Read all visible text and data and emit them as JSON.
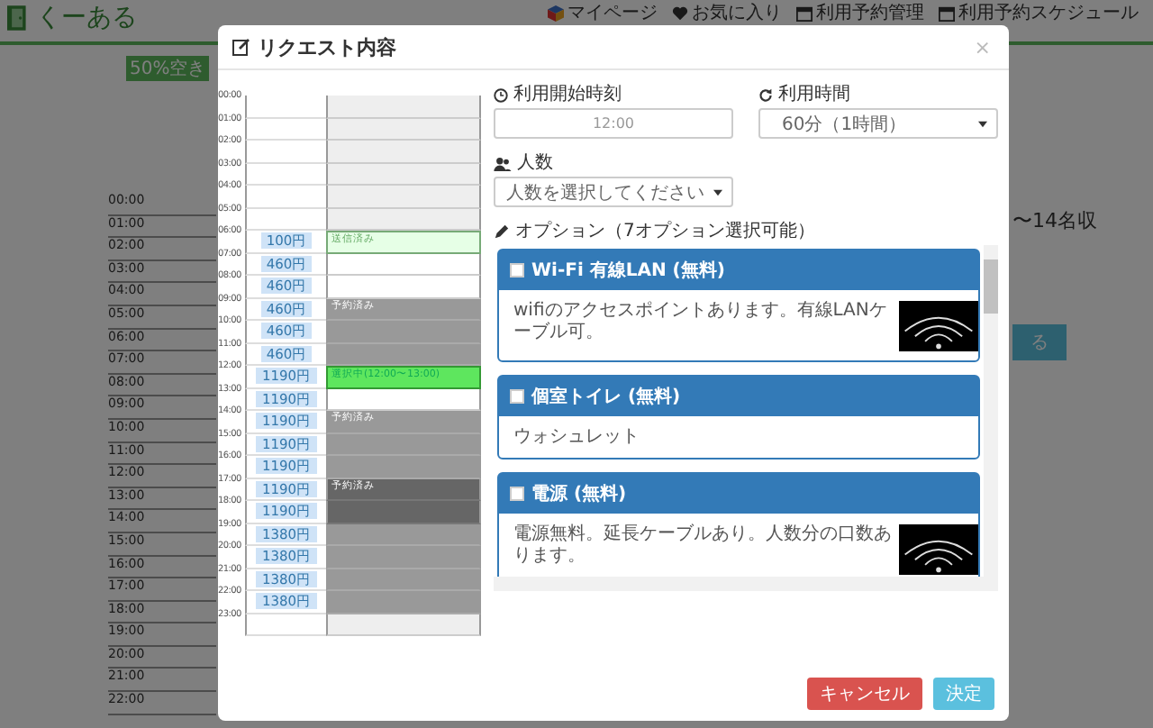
{
  "header": {
    "logo": "くーある",
    "nav": [
      {
        "label": "マイページ"
      },
      {
        "label": "お気に入り"
      },
      {
        "label": "利用予約管理"
      },
      {
        "label": "利用予約スケジュール"
      }
    ]
  },
  "background": {
    "badge": "50%空き",
    "capacity_text": "〜14名収",
    "button": "る",
    "times": [
      "00:00",
      "01:00",
      "02:00",
      "03:00",
      "04:00",
      "05:00",
      "06:00",
      "07:00",
      "08:00",
      "09:00",
      "10:00",
      "11:00",
      "12:00",
      "13:00",
      "14:00",
      "15:00",
      "16:00",
      "17:00",
      "18:00",
      "19:00",
      "20:00",
      "21:00",
      "22:00"
    ]
  },
  "modal": {
    "title": "リクエスト内容",
    "close": "×",
    "schedule": [
      {
        "time": "00:00",
        "kind": "closed"
      },
      {
        "time": "01:00",
        "kind": "closed"
      },
      {
        "time": "02:00",
        "kind": "closed"
      },
      {
        "time": "03:00",
        "kind": "closed"
      },
      {
        "time": "04:00",
        "kind": "closed"
      },
      {
        "time": "05:00",
        "kind": "closed"
      },
      {
        "time": "06:00",
        "price": "100円",
        "kind": "done",
        "label": "送信済み"
      },
      {
        "time": "07:00",
        "price": "460円",
        "kind": "open"
      },
      {
        "time": "08:00",
        "price": "460円",
        "kind": "open"
      },
      {
        "time": "09:00",
        "price": "460円",
        "kind": "booked",
        "label": "予約済み"
      },
      {
        "time": "10:00",
        "price": "460円",
        "kind": "booked"
      },
      {
        "time": "11:00",
        "price": "460円",
        "kind": "booked"
      },
      {
        "time": "12:00",
        "price": "1190円",
        "kind": "selected",
        "label": "選択中(12:00〜13:00)"
      },
      {
        "time": "13:00",
        "price": "1190円",
        "kind": "open"
      },
      {
        "time": "14:00",
        "price": "1190円",
        "kind": "booked",
        "label": "予約済み"
      },
      {
        "time": "15:00",
        "price": "1190円",
        "kind": "booked"
      },
      {
        "time": "16:00",
        "price": "1190円",
        "kind": "booked"
      },
      {
        "time": "17:00",
        "price": "1190円",
        "kind": "booked_dark",
        "label": "予約済み"
      },
      {
        "time": "18:00",
        "price": "1190円",
        "kind": "booked_dark"
      },
      {
        "time": "19:00",
        "price": "1380円",
        "kind": "booked"
      },
      {
        "time": "20:00",
        "price": "1380円",
        "kind": "booked"
      },
      {
        "time": "21:00",
        "price": "1380円",
        "kind": "booked"
      },
      {
        "time": "22:00",
        "price": "1380円",
        "kind": "booked"
      },
      {
        "time": "23:00",
        "kind": "closed"
      }
    ],
    "form": {
      "start_time": {
        "label": "利用開始時刻",
        "value": "12:00"
      },
      "duration": {
        "label": "利用時間",
        "value": "60分（1時間）"
      },
      "people": {
        "label": "人数",
        "placeholder": "人数を選択してください"
      }
    },
    "options": {
      "label": "オプション（7オプション選択可能）",
      "items": [
        {
          "title": "Wi-Fi 有線LAN (無料)",
          "description": "wifiのアクセスポイントあります。有線LANケーブル可。",
          "checked": false
        },
        {
          "title": "個室トイレ (無料)",
          "description": "ウォシュレット",
          "checked": false
        },
        {
          "title": "電源 (無料)",
          "description": "電源無料。延長ケーブルあり。人数分の口数あります。",
          "checked": false
        }
      ]
    },
    "buttons": [
      {
        "label": "キャンセル",
        "kind": "cancel"
      },
      {
        "label": "決定",
        "kind": "submit"
      }
    ]
  }
}
